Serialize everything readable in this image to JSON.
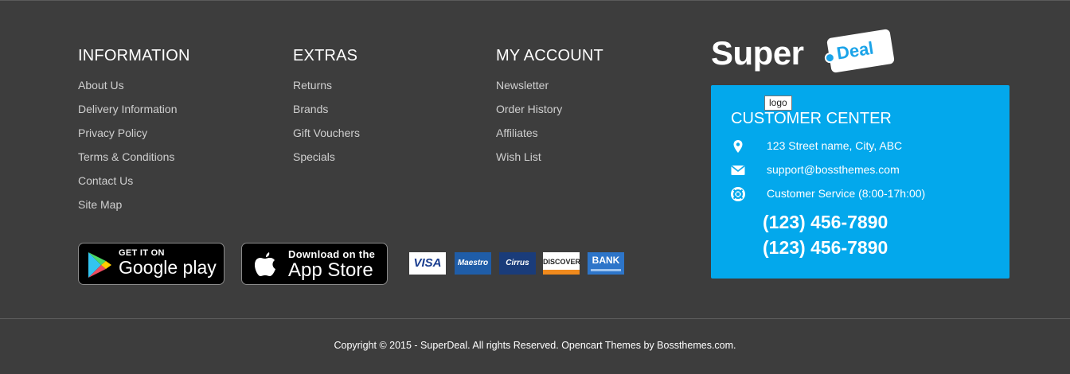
{
  "columns": {
    "information": {
      "title": "INFORMATION",
      "links": [
        "About Us",
        "Delivery Information",
        "Privacy Policy",
        "Terms & Conditions",
        "Contact Us",
        "Site Map"
      ]
    },
    "extras": {
      "title": "EXTRAS",
      "links": [
        "Returns",
        "Brands",
        "Gift Vouchers",
        "Specials"
      ]
    },
    "account": {
      "title": "MY ACCOUNT",
      "links": [
        "Newsletter",
        "Order History",
        "Affiliates",
        "Wish List"
      ]
    }
  },
  "badges": {
    "google": {
      "small": "GET IT ON",
      "big": "Google play",
      "icon": "google-play-icon"
    },
    "apple": {
      "small": "Download on the",
      "big": "App Store",
      "icon": "apple-icon"
    }
  },
  "payments": {
    "visa": "VISA",
    "maestro": "Maestro",
    "cirrus": "Cirrus",
    "discover": "DISCOVER",
    "bank": "BANK"
  },
  "logo": {
    "main": "Super",
    "tag": "Deal",
    "tooltip": "logo"
  },
  "customer_center": {
    "title": "CUSTOMER CENTER",
    "address": "123 Street name, City, ABC",
    "email": "support@bossthemes.com",
    "service": "Customer Service (8:00-17h:00)",
    "phone_1": "(123) 456-7890",
    "phone_2": "(123) 456-7890",
    "icons": [
      "map-marker-icon",
      "envelope-icon",
      "life-ring-icon"
    ]
  },
  "copyright": "Copyright © 2015 - SuperDeal. All rights Reserved. Opencart Themes by Bossthemes.com.",
  "colors": {
    "background": "#3d3d3d",
    "accent": "#03a8ec",
    "text_muted": "#cfcfcf"
  }
}
